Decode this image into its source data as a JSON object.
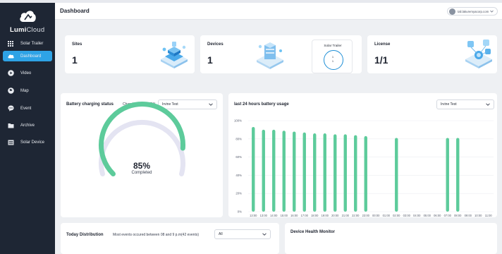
{
  "colors": {
    "sidebar_bg": "#1e2634",
    "active_nav": "#2ea3e6",
    "bar_green": "#5dcb9b",
    "gauge_track": "#e4e4f2",
    "ring_blue": "#1f8fd6"
  },
  "brand": {
    "name_bold": "Lumi",
    "name_light": "Cloud"
  },
  "sidebar": {
    "items": [
      {
        "label": "Solar Trailer",
        "icon": "grid-icon",
        "active": false
      },
      {
        "label": "Dashboard",
        "icon": "cloud-icon",
        "active": true
      },
      {
        "label": "Video",
        "icon": "play-icon",
        "active": false
      },
      {
        "label": "Map",
        "icon": "map-icon",
        "active": false
      },
      {
        "label": "Event",
        "icon": "chat-icon",
        "active": false
      },
      {
        "label": "Archive",
        "icon": "folder-icon",
        "active": false
      },
      {
        "label": "Solar Device",
        "icon": "list-icon",
        "active": false
      }
    ]
  },
  "header": {
    "title": "Dashboard",
    "user_email": "tali.lakuremyacorp.com"
  },
  "stats": {
    "sites": {
      "label": "Sites",
      "value": "1"
    },
    "devices": {
      "label": "Devices",
      "value": "1"
    },
    "solar_trailer": {
      "title": "Solar Trailer",
      "top": "1",
      "bottom": "1"
    },
    "license": {
      "label": "License",
      "value": "1/1"
    }
  },
  "battery_status": {
    "title": "Battery charging status",
    "power_label": "Charging Power: 0W",
    "select_value": "Irvine Test",
    "percent_text": "85%",
    "percent_value": 0.85,
    "status_text": "Completed"
  },
  "usage": {
    "title": "last 24 hours battery usage",
    "select_value": "Irvine Test"
  },
  "distribution": {
    "title": "Today Distribution",
    "subtitle": "Most events occured between 08 and 9 p.m(42 events)",
    "select_value": "All"
  },
  "health": {
    "title": "Device Health Monitor"
  },
  "chart_data": {
    "type": "bar",
    "categories": [
      "13:00",
      "13:00",
      "14:00",
      "15:00",
      "16:00",
      "17:00",
      "18:00",
      "19:00",
      "20:00",
      "21:00",
      "22:00",
      "23:00",
      "00:00",
      "01:00",
      "02:00",
      "03:00",
      "04:00",
      "05:00",
      "06:00",
      "07:00",
      "08:00",
      "09:00",
      "10:00",
      "11:00"
    ],
    "values": [
      93,
      90,
      90,
      89,
      88,
      87,
      86,
      86,
      85,
      85,
      84,
      83,
      null,
      null,
      81,
      null,
      null,
      null,
      null,
      81,
      81,
      null,
      null,
      null
    ],
    "y_ticks": [
      "0%",
      "20%",
      "40%",
      "60%",
      "80%",
      "100%"
    ],
    "ylim": [
      0,
      100
    ],
    "grid": true
  }
}
